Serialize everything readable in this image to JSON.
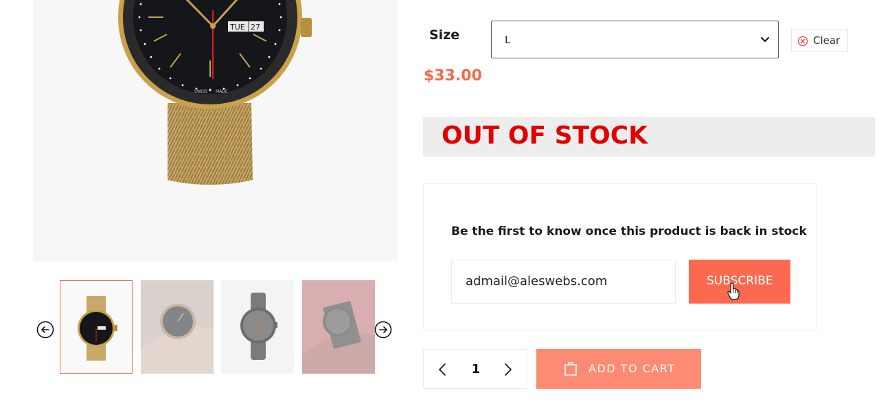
{
  "product": {
    "size_label": "Size",
    "size_selected": "L",
    "clear_label": "Clear",
    "price": "$33.00",
    "stock_status": "OUT OF STOCK"
  },
  "watch_dial": {
    "day": "TUE",
    "date": "27",
    "dial_text_left": "SWISS",
    "dial_text_right": "MADE"
  },
  "notify": {
    "heading": "Be the first to know once this product is back in stock",
    "email_value": "admail@aleswebs.com",
    "subscribe_label": "SUBSCRIBE"
  },
  "cart": {
    "quantity": "1",
    "add_to_cart_label": "ADD TO CART"
  },
  "gallery": {
    "selected_thumbnail": 1,
    "thumbnail_count": 4
  },
  "colors": {
    "accent": "#f26a4f",
    "subscribe_bg": "#fb6a50",
    "add_to_cart_bg": "#fd8a73",
    "out_of_stock": "#e00000"
  },
  "icons": {
    "thumb_prev": "arrow-left-circle-icon",
    "thumb_next": "arrow-right-circle-icon",
    "clear": "close-circle-icon",
    "select": "chevron-down-icon",
    "qty_dec": "chevron-left-icon",
    "qty_inc": "chevron-right-icon",
    "cart": "shopping-bag-icon",
    "cursor": "hand-pointer-icon"
  }
}
